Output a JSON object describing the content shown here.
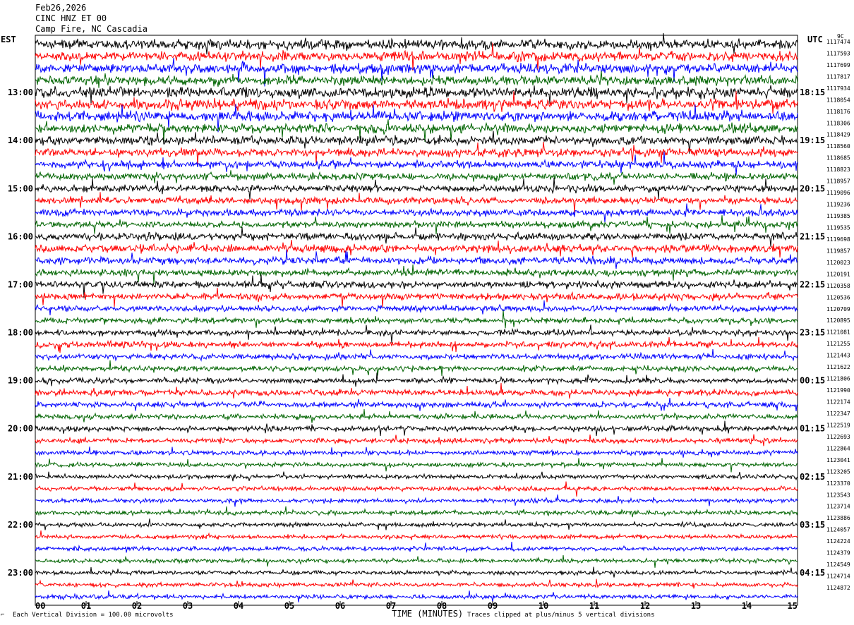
{
  "header": {
    "date": "Feb26,2026",
    "channel": "CINC HNZ ET 00",
    "location": "Camp Fire, NC Cascadia"
  },
  "left_tz": "EST",
  "right_tz": "UTC",
  "corner_mark": "9C",
  "footer": {
    "scale_note": "Each Vertical Division =  100.00 microvolts",
    "xlabel": "TIME (MINUTES)",
    "clip_note": "Traces clipped at plus/minus 5 vertical divisions"
  },
  "colors": {
    "trace_cycle": [
      "#000000",
      "#ff0000",
      "#0000ff",
      "#006400"
    ]
  },
  "chart_data": {
    "type": "line",
    "title": "Feb26,2026 CINC HNZ ET 00",
    "xlabel": "TIME (MINUTES)",
    "x_ticks": [
      "00",
      "01",
      "02",
      "03",
      "04",
      "05",
      "06",
      "07",
      "08",
      "09",
      "10",
      "11",
      "12",
      "13",
      "14",
      "15"
    ],
    "xlim": [
      0,
      15
    ],
    "minutes_per_line": 15,
    "lines_per_hour": 4,
    "left_hour_labels": [
      "13:00",
      "14:00",
      "15:00",
      "16:00",
      "17:00",
      "18:00",
      "19:00",
      "20:00",
      "21:00",
      "22:00",
      "23:00"
    ],
    "right_hour_labels": [
      "18:15",
      "19:15",
      "20:15",
      "21:15",
      "22:15",
      "23:15",
      "00:15",
      "01:15",
      "02:15",
      "03:15",
      "04:15"
    ],
    "first_labeled_line": 4,
    "line_count": 47,
    "row_values": [
      1117474,
      1117593,
      1117699,
      1117817,
      1117934,
      1118054,
      1118176,
      1118306,
      1118429,
      1118560,
      1118685,
      1118823,
      1118957,
      1119096,
      1119236,
      1119385,
      1119535,
      1119698,
      1119857,
      1120023,
      1120191,
      1120358,
      1120536,
      1120709,
      1120895,
      1121081,
      1121255,
      1121443,
      1121622,
      1121806,
      1121990,
      1122174,
      1122347,
      1122519,
      1122693,
      1122864,
      1123041,
      1123205,
      1123370,
      1123543,
      1123714,
      1123886,
      1124057,
      1124224,
      1124379,
      1124549,
      1124714,
      1124872
    ],
    "amplitude_profile": [
      4.5,
      4.4,
      4.6,
      4.5,
      5.0,
      5.0,
      4.8,
      4.3,
      4.0,
      3.8,
      3.6,
      3.5,
      3.3,
      3.2,
      3.2,
      3.1,
      3.4,
      3.6,
      3.4,
      3.2,
      3.4,
      3.1,
      2.7,
      2.6,
      2.6,
      2.9,
      2.7,
      2.5,
      2.5,
      2.8,
      2.7,
      2.4,
      2.3,
      2.3,
      2.2,
      2.1,
      2.0,
      2.0,
      2.0,
      2.0,
      2.0,
      2.0,
      2.0,
      2.0,
      1.9,
      2.0,
      2.0,
      2.0
    ],
    "y_unit": "microvolts",
    "vertical_division_microvolts": 100.0,
    "clip_divisions": 5
  }
}
